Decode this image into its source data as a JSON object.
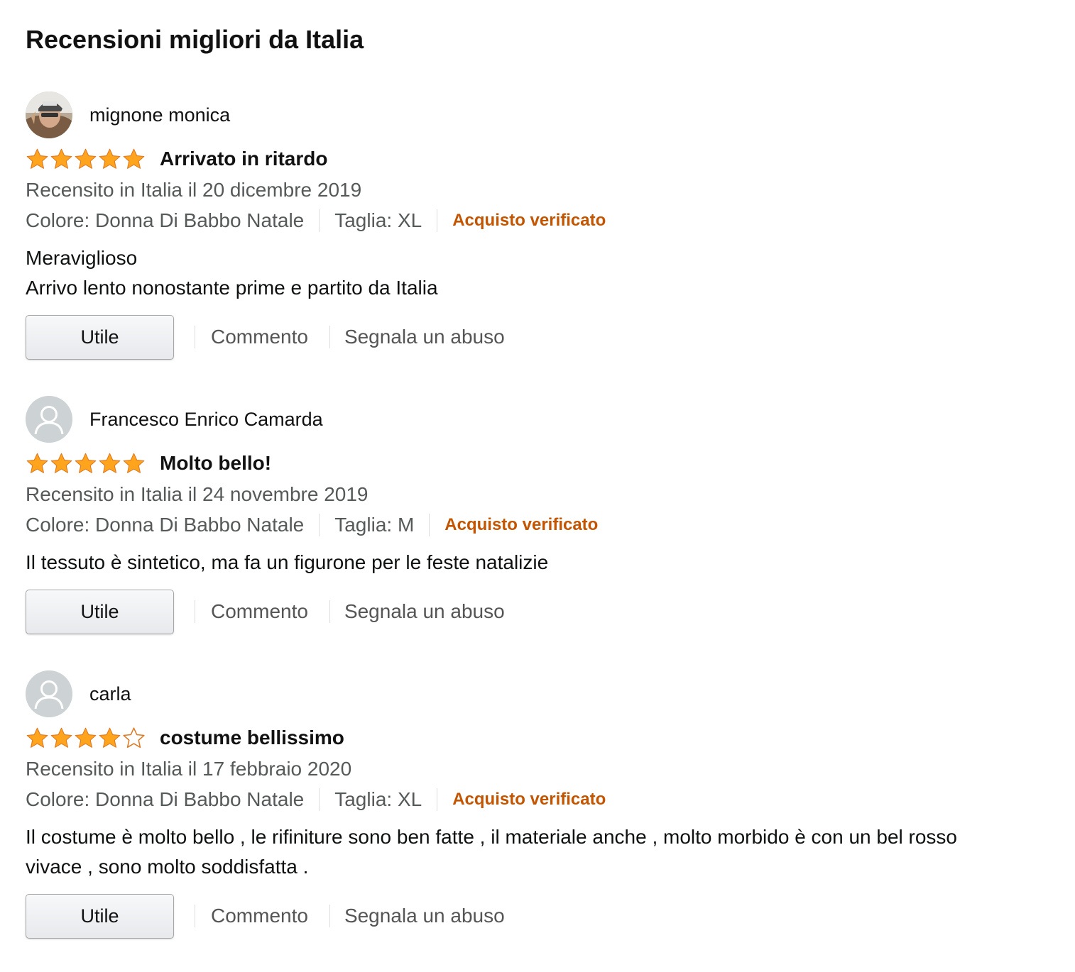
{
  "section": {
    "title": "Recensioni migliori da Italia"
  },
  "colors": {
    "star": "#ffa41c",
    "star_stroke": "#de7921",
    "verified": "#c45500",
    "meta_text": "#565959",
    "link": "#555555"
  },
  "reviews": [
    {
      "author": "mignone monica",
      "avatar": "user-photo",
      "rating": 5,
      "rating_max": 5,
      "title": "Arrivato in ritardo",
      "date": "Recensito in Italia il 20 dicembre 2019",
      "color": "Colore: Donna Di Babbo Natale",
      "size": "Taglia: XL",
      "verified": "Acquisto verificato",
      "body_lines": [
        "Meraviglioso",
        "Arrivo lento nonostante prime e partito da Italia"
      ],
      "helpful_label": "Utile",
      "comment_label": "Commento",
      "report_label": "Segnala un abuso"
    },
    {
      "author": "Francesco Enrico Camarda",
      "avatar": "default-avatar-icon",
      "rating": 5,
      "rating_max": 5,
      "title": "Molto bello!",
      "date": "Recensito in Italia il 24 novembre 2019",
      "color": "Colore: Donna Di Babbo Natale",
      "size": "Taglia: M",
      "verified": "Acquisto verificato",
      "body_lines": [
        "Il tessuto è sintetico, ma fa un figurone per le feste natalizie"
      ],
      "helpful_label": "Utile",
      "comment_label": "Commento",
      "report_label": "Segnala un abuso"
    },
    {
      "author": "carla",
      "avatar": "default-avatar-icon",
      "rating": 4,
      "rating_max": 5,
      "title": "costume bellissimo",
      "date": "Recensito in Italia il 17 febbraio 2020",
      "color": "Colore: Donna Di Babbo Natale",
      "size": "Taglia: XL",
      "verified": "Acquisto verificato",
      "body_lines": [
        "Il costume è molto bello , le rifiniture sono ben fatte , il materiale anche , molto morbido è con un bel rosso",
        "vivace , sono molto soddisfatta ."
      ],
      "helpful_label": "Utile",
      "comment_label": "Commento",
      "report_label": "Segnala un abuso"
    }
  ]
}
